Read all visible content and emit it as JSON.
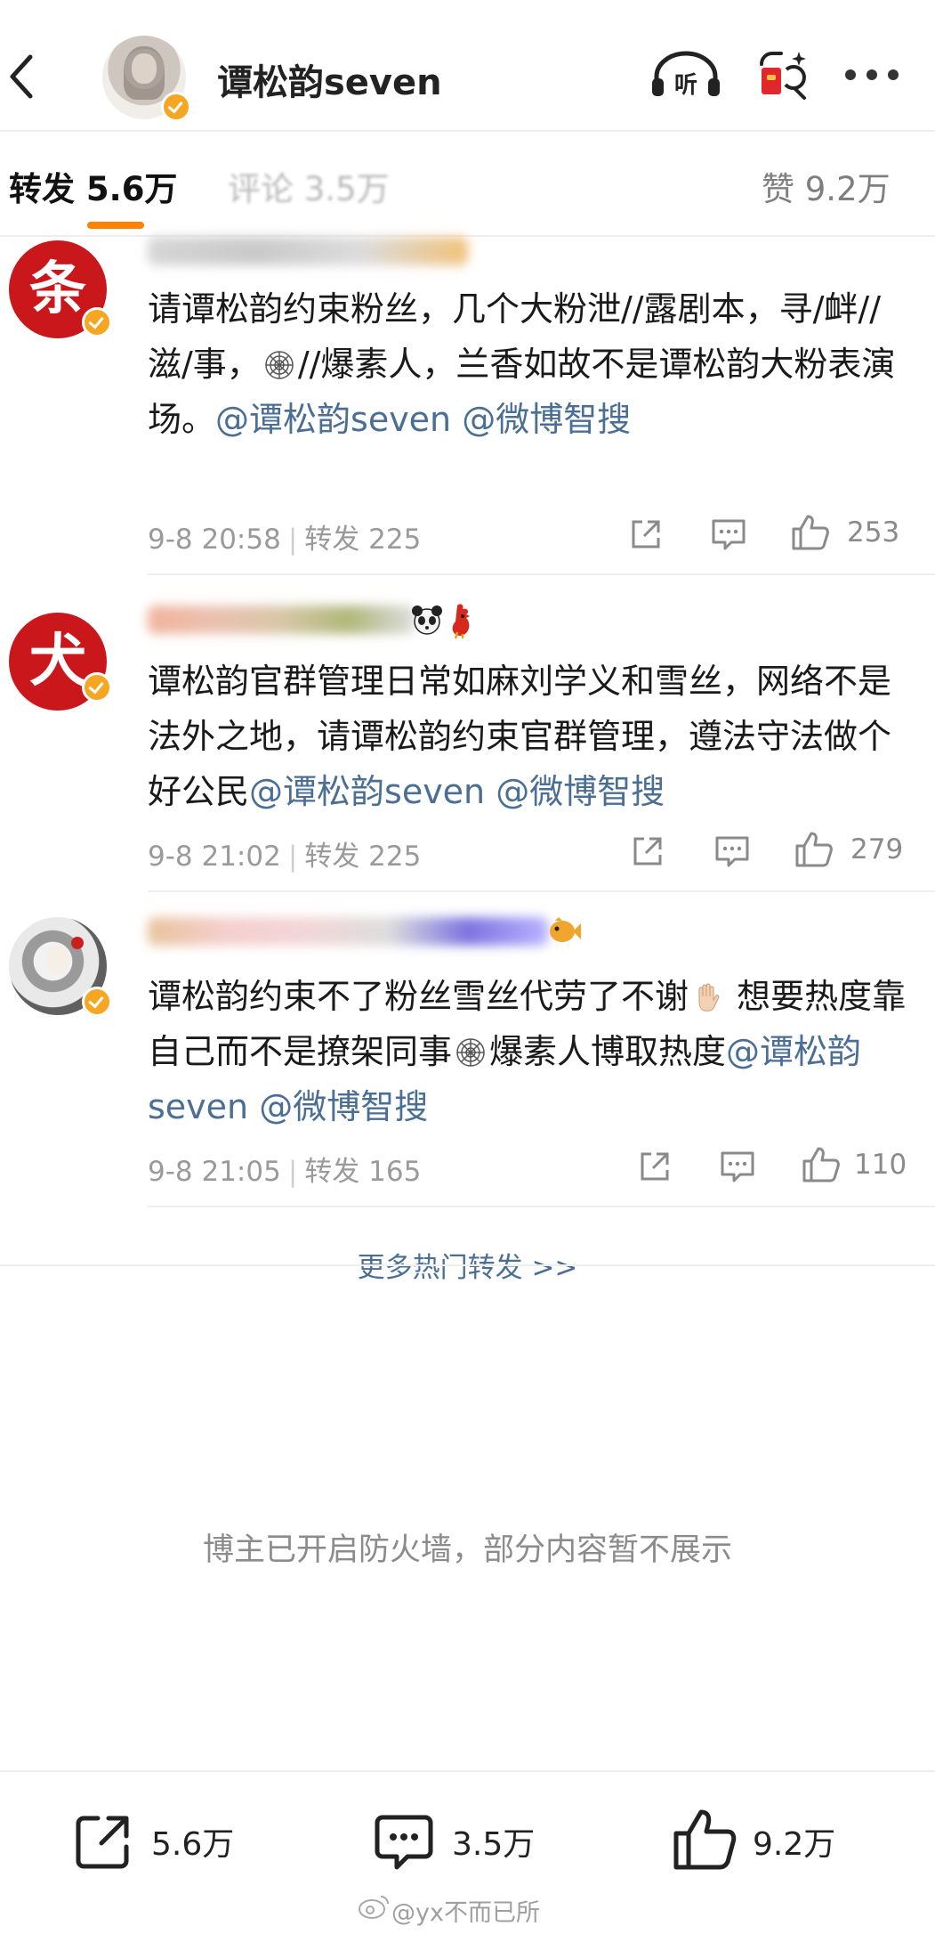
{
  "header": {
    "title": "谭松韵seven",
    "icons": [
      "chevron-left-icon",
      "listen-icon",
      "red-packet-search-icon",
      "more-icon"
    ],
    "listen_label": "听"
  },
  "tabs": {
    "repost_label": "转发",
    "repost_count": "5.6万",
    "comment_label": "评论",
    "comment_count": "3.5万",
    "like_label": "赞",
    "like_count": "9.2万",
    "active_color": "#ff8200"
  },
  "reposts": [
    {
      "avatar_char": "条",
      "text_parts": [
        "请谭松韵约束粉丝，几个大粉泄//露剧本，寻/衅//滋/事，",
        "//爆素人，兰香如故不是谭松韵大粉表演场。"
      ],
      "mentions": [
        "@谭松韵seven",
        "@微博智搜"
      ],
      "time": "9-8 20:58",
      "repost_text": "转发 225",
      "likes": "253"
    },
    {
      "avatar_char": "犬",
      "text_parts": [
        "谭松韵官群管理日常如麻刘学义和雪丝，网络不是法外之地，请谭松韵约束官群管理，遵法守法做个好公民"
      ],
      "mentions": [
        "@谭松韵seven",
        "@微博智搜"
      ],
      "time": "9-8 21:02",
      "repost_text": "转发 225",
      "likes": "279"
    },
    {
      "avatar_char": "",
      "text_parts": [
        "谭松韵约束不了粉丝雪丝代劳了不谢",
        " 想要热度靠自己而不是撩架同事",
        "爆素人博取热度"
      ],
      "mentions": [
        "@谭松韵seven",
        "@微博智搜"
      ],
      "time": "9-8 21:05",
      "repost_text": "转发 165",
      "likes": "110"
    }
  ],
  "more_link": "更多热门转发 >>",
  "firewall_notice": "博主已开启防火墙，部分内容暂不展示",
  "bottom_bar": {
    "repost_count": "5.6万",
    "comment_count": "3.5万",
    "like_count": "9.2万"
  },
  "watermark": "@yx不而已所",
  "link_color": "#4a6e94"
}
